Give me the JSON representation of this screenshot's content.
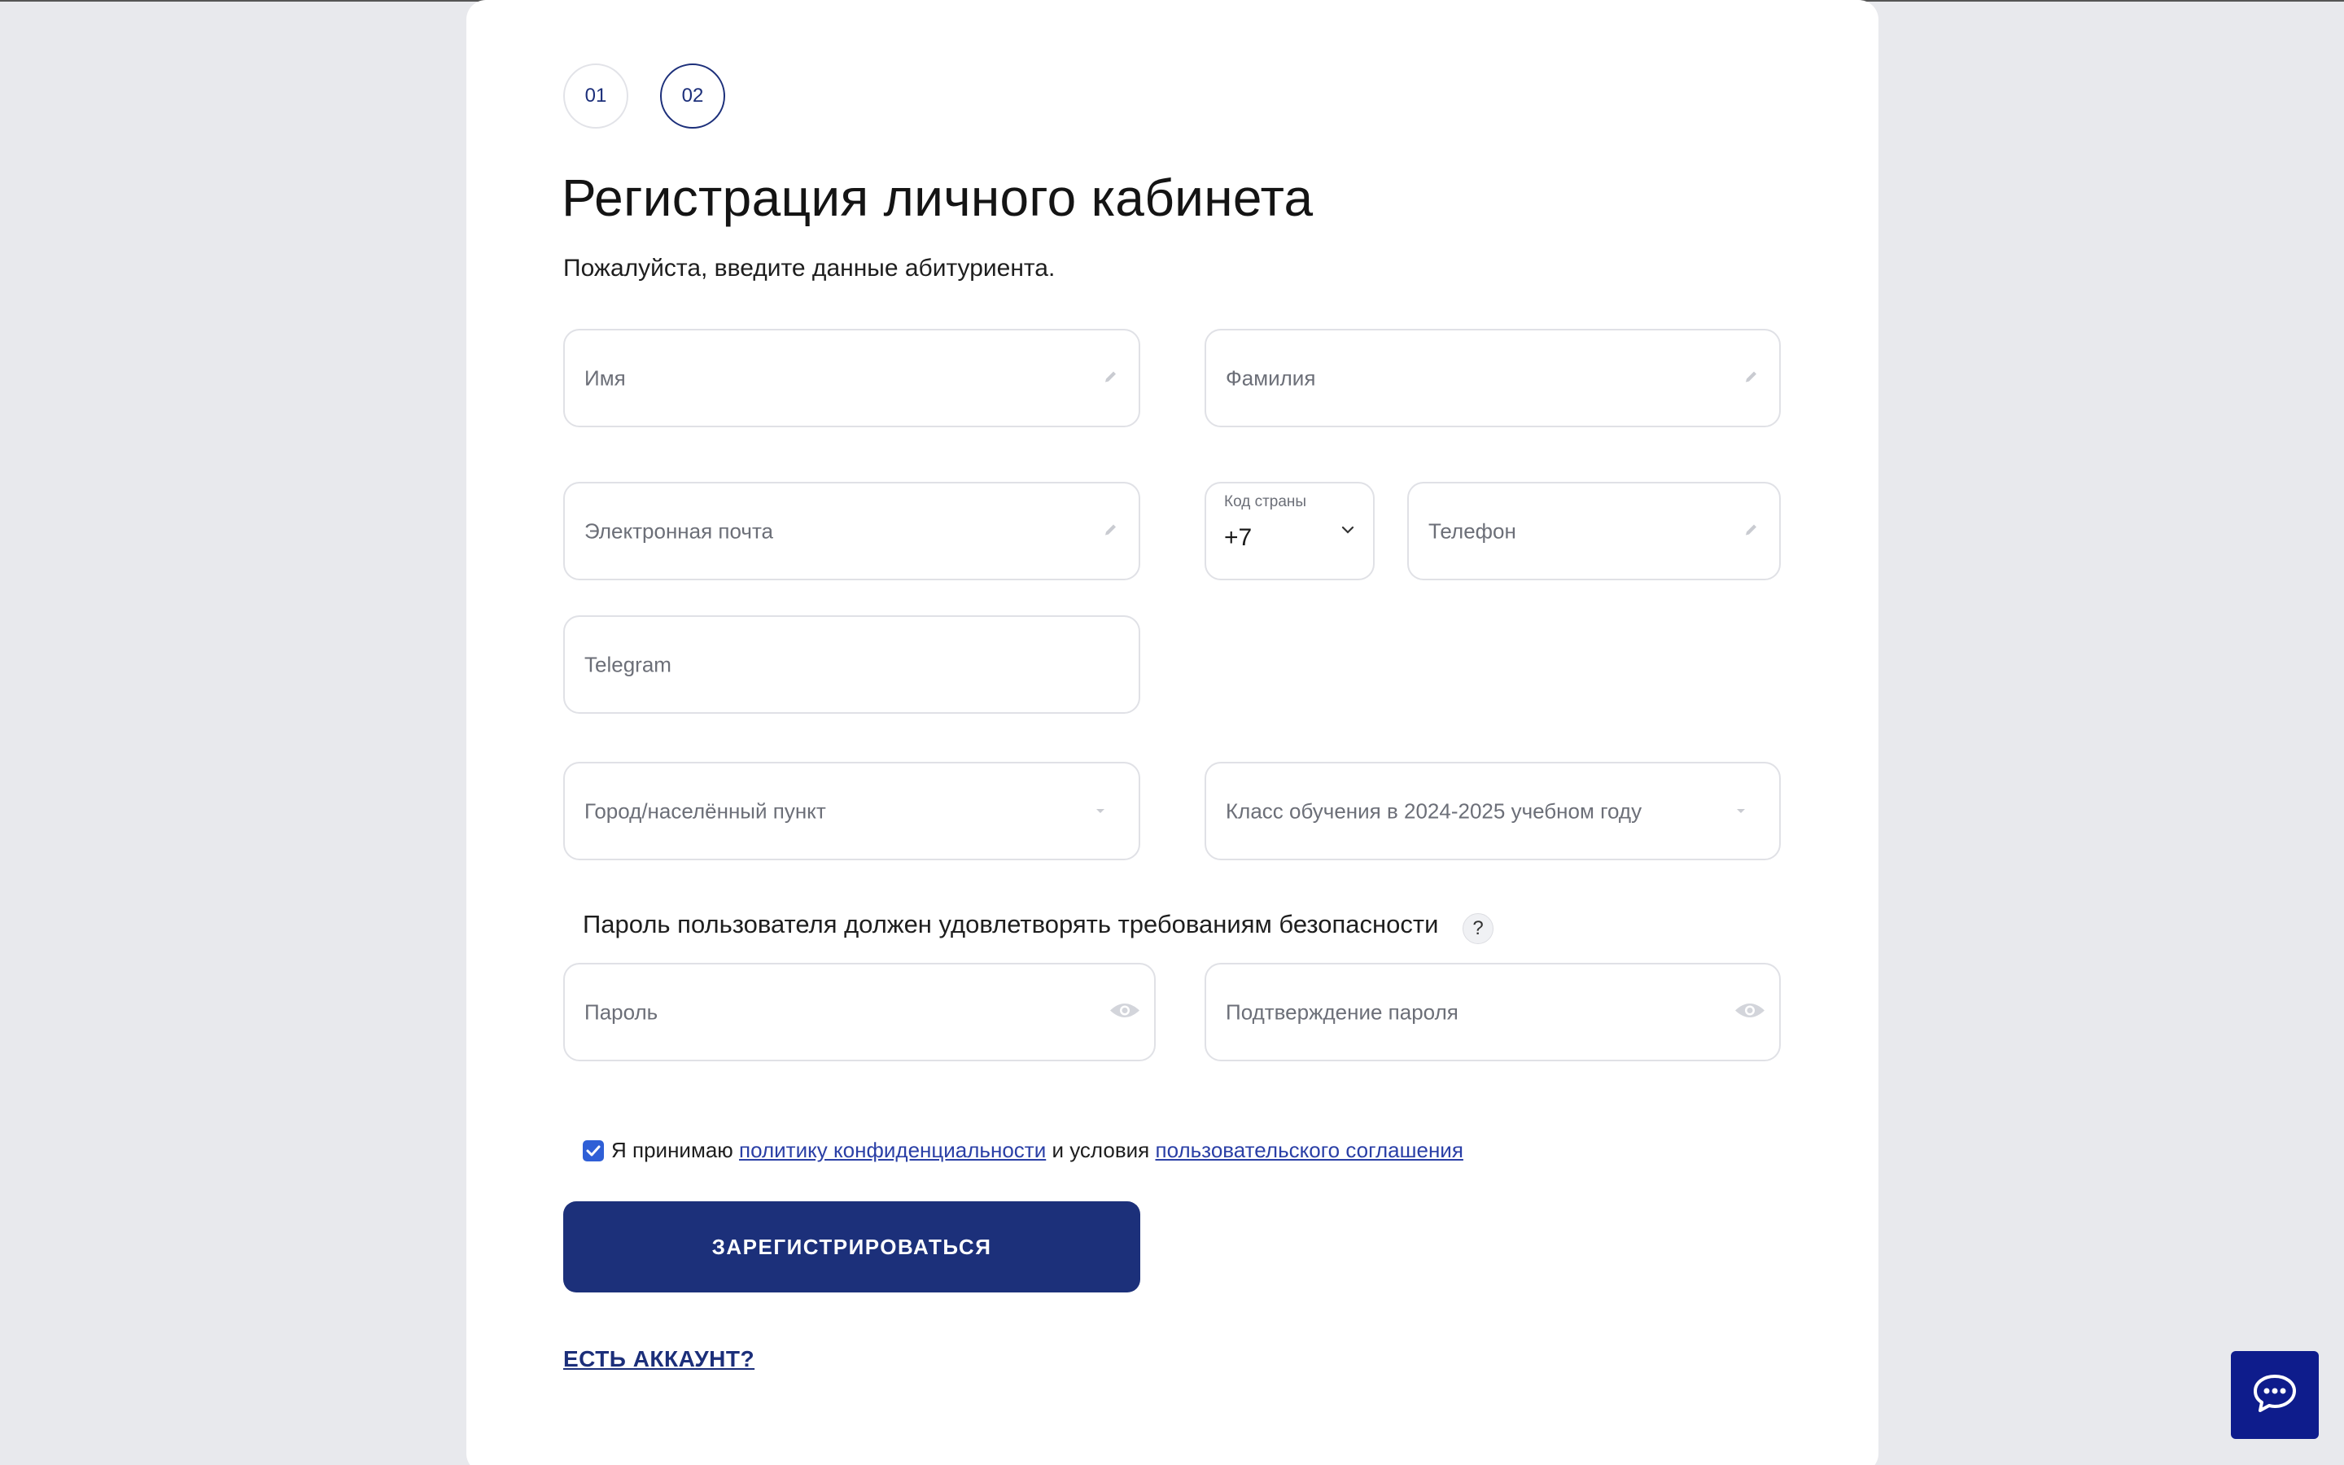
{
  "steps": [
    {
      "label": "01",
      "active": false
    },
    {
      "label": "02",
      "active": true
    }
  ],
  "header": {
    "title": "Регистрация личного кабинета",
    "subtitle": "Пожалуйста, введите данные абитуриента."
  },
  "form": {
    "first_name": {
      "placeholder": "Имя",
      "icon": "pencil-icon"
    },
    "last_name": {
      "placeholder": "Фамилия",
      "icon": "pencil-icon"
    },
    "email": {
      "placeholder": "Электронная почта",
      "icon": "pencil-icon"
    },
    "country_code": {
      "label": "Код страны",
      "value": "+7",
      "icon": "chevron-down-icon"
    },
    "phone": {
      "placeholder": "Телефон",
      "icon": "pencil-icon"
    },
    "telegram": {
      "placeholder": "Telegram"
    },
    "city": {
      "placeholder": "Город/населённый пункт",
      "icon": "caret-down-icon"
    },
    "grade": {
      "placeholder": "Класс обучения в 2024-2025 учебном году",
      "icon": "caret-down-icon"
    },
    "password_hint": "Пароль пользователя должен удовлетворять требованиям безопасности",
    "password_help": "?",
    "password": {
      "placeholder": "Пароль",
      "icon": "eye-icon"
    },
    "password_confirm": {
      "placeholder": "Подтверждение пароля",
      "icon": "eye-icon"
    }
  },
  "consent": {
    "checked": true,
    "text_1": "Я принимаю",
    "link_privacy": "политику конфиденциальности",
    "text_2": "и условия",
    "link_terms": "пользовательского соглашения"
  },
  "actions": {
    "register_label": "ЗАРЕГИСТРИРОВАТЬСЯ",
    "have_account_label": "ЕСТЬ АККАУНТ?"
  },
  "chat": {
    "icon": "chat-bubble-icon"
  },
  "colors": {
    "primary": "#1c307a",
    "page_bg": "#e8e9ed",
    "link": "#2a3fa6",
    "checkbox": "#2f5fd6",
    "chat_button": "#0e1c8c"
  }
}
